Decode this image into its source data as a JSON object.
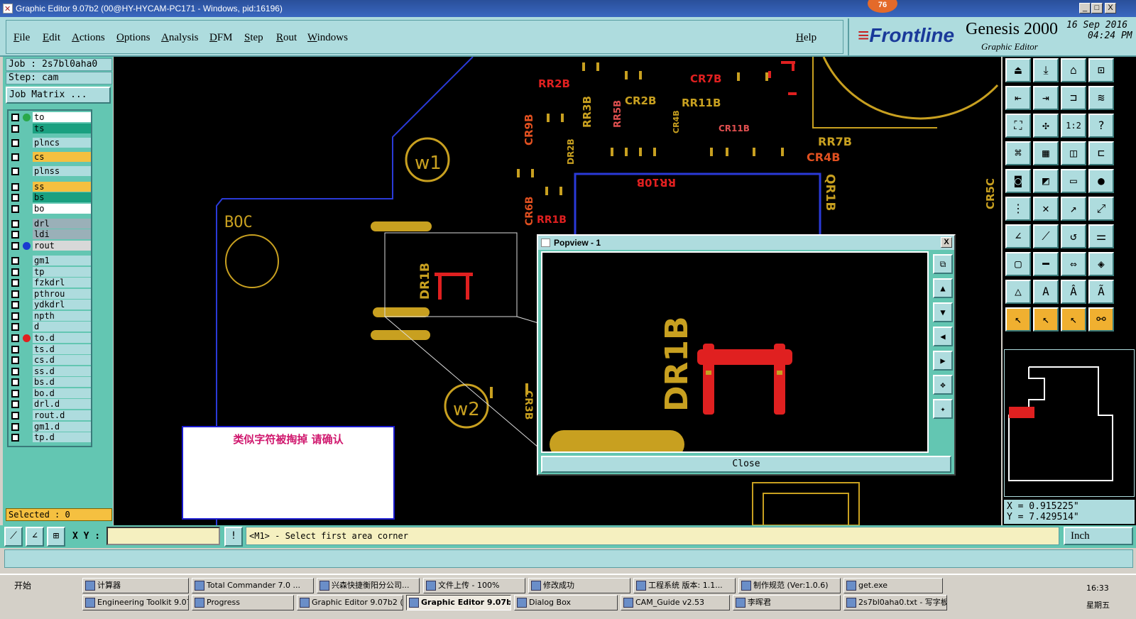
{
  "window": {
    "title": "Graphic Editor 9.07b2 (00@HY-HYCAM-PC171 - Windows, pid:16196)",
    "badge": "76",
    "min": "_",
    "max": "□",
    "close": "X"
  },
  "menu": {
    "file": "File",
    "edit": "Edit",
    "actions": "Actions",
    "options": "Options",
    "analysis": "Analysis",
    "dfm": "DFM",
    "step": "Step",
    "rout": "Rout",
    "windows": "Windows",
    "help": "Help"
  },
  "brand": {
    "frontline": "Frontline",
    "product": "Genesis 2000",
    "subtitle": "Graphic Editor",
    "date": "16 Sep 2016",
    "time": "04:24 PM"
  },
  "job": {
    "job_label": "Job : 2s7bl0aha0",
    "step_label": "Step: cam",
    "matrix_button": "Job Matrix ..."
  },
  "layers": [
    {
      "name": "to",
      "bg": "#ffffff",
      "dot": "#2aa84a"
    },
    {
      "name": "ts",
      "bg": "#1aa080",
      "dot": ""
    },
    {
      "name": "plncs",
      "bg": "#aedcde",
      "dot": ""
    },
    {
      "name": "cs",
      "bg": "#f5c040",
      "dot": ""
    },
    {
      "name": "plnss",
      "bg": "#aedcde",
      "dot": ""
    },
    {
      "name": "ss",
      "bg": "#f5c040",
      "dot": ""
    },
    {
      "name": "bs",
      "bg": "#1aa080",
      "dot": ""
    },
    {
      "name": "bo",
      "bg": "#ffffff",
      "dot": ""
    },
    {
      "name": "drl",
      "bg": "#9ab0b8",
      "dot": ""
    },
    {
      "name": "ldi",
      "bg": "#9ab0b8",
      "dot": ""
    },
    {
      "name": "rout",
      "bg": "#d8d8d8",
      "dot": "#1a3ad0"
    },
    {
      "name": "gm1",
      "bg": "#aedcde",
      "dot": ""
    },
    {
      "name": "tp",
      "bg": "#aedcde",
      "dot": ""
    },
    {
      "name": "fzkdrl",
      "bg": "#aedcde",
      "dot": ""
    },
    {
      "name": "pthrou",
      "bg": "#aedcde",
      "dot": ""
    },
    {
      "name": "ydkdrl",
      "bg": "#aedcde",
      "dot": ""
    },
    {
      "name": "npth",
      "bg": "#aedcde",
      "dot": ""
    },
    {
      "name": "d",
      "bg": "#aedcde",
      "dot": ""
    },
    {
      "name": "to.d",
      "bg": "#aedcde",
      "dot": "#e02020"
    },
    {
      "name": "ts.d",
      "bg": "#aedcde",
      "dot": ""
    },
    {
      "name": "cs.d",
      "bg": "#aedcde",
      "dot": ""
    },
    {
      "name": "ss.d",
      "bg": "#aedcde",
      "dot": ""
    },
    {
      "name": "bs.d",
      "bg": "#aedcde",
      "dot": ""
    },
    {
      "name": "bo.d",
      "bg": "#aedcde",
      "dot": ""
    },
    {
      "name": "drl.d",
      "bg": "#aedcde",
      "dot": ""
    },
    {
      "name": "rout.d",
      "bg": "#aedcde",
      "dot": ""
    },
    {
      "name": "gm1.d",
      "bg": "#aedcde",
      "dot": ""
    },
    {
      "name": "tp.d",
      "bg": "#aedcde",
      "dot": ""
    }
  ],
  "selected": "Selected : 0",
  "canvas_labels": {
    "boc": "BOC",
    "w1": "w1",
    "w2": "w2",
    "dr1b": "DR1B",
    "rr2b": "RR2B",
    "rr3b": "RR3B",
    "cr9b": "CR9B",
    "cr2b": "CR2B",
    "rr5b": "RR5B",
    "cr4b_small": "CR4B",
    "rr11b": "RR11B",
    "cr7b": "CR7B",
    "cr11b": "CR11B",
    "rr7b": "RR7B",
    "cr4b": "CR4B",
    "dr2b": "DR2B",
    "rr10b": "RR10B",
    "qr1b": "QR1B",
    "cr5c": "CR5C",
    "cr6b": "CR6B",
    "rr1b": "RR1B",
    "cr3b": "CR3B"
  },
  "note": {
    "text": "类似字符被掏掉 请确认"
  },
  "popview": {
    "title": "Popview - 1",
    "label": "DR1B",
    "close_button": "Close"
  },
  "coords": {
    "x": "X = 0.915225\"",
    "y": "Y = 7.429514\""
  },
  "bottom": {
    "xy_label": "X Y :",
    "xy_value": "",
    "message": "<M1> - Select first area corner",
    "units": "Inch"
  },
  "taskbar": {
    "start": "开始",
    "row1": [
      "计算器",
      "Total Commander 7.0 ...",
      "兴森快捷衡阳分公司...",
      "文件上传 - 100%",
      "修改成功",
      "工程系统  版本: 1.1...",
      "制作规范 (Ver:1.0.6)",
      "get.exe"
    ],
    "row2": [
      "Engineering Toolkit 9.07...",
      "Progress",
      "Graphic Editor 9.07b2 (...",
      "Graphic Editor 9.07b...",
      "Dialog Box",
      "CAM_Guide v2.53",
      "李晖君",
      "2s7bl0aha0.txt - 写字板"
    ],
    "clock": "16:33",
    "weekday": "星期五"
  }
}
